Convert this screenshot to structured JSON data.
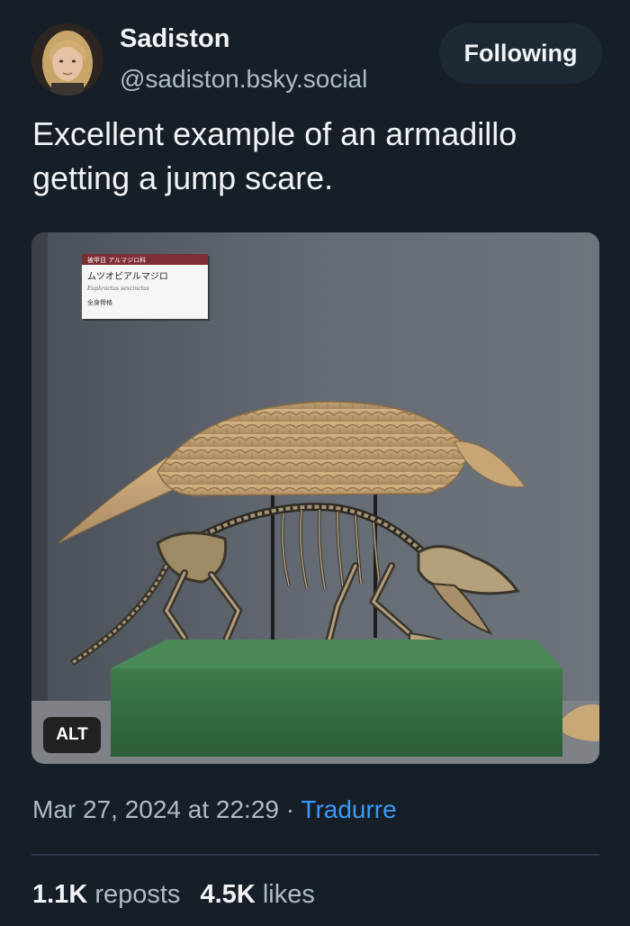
{
  "author": {
    "display_name": "Sadiston",
    "handle": "@sadiston.bsky.social"
  },
  "follow_button": {
    "label": "Following"
  },
  "post": {
    "text": "Excellent example of an armadillo getting a jump scare.",
    "image": {
      "alt_badge": "ALT",
      "label_card": {
        "line1": "被甲目 アルマジロ科",
        "line2": "ムツオビアルマジロ",
        "line3": "Euphractus sexcinctus",
        "line4": "全身骨格"
      }
    },
    "timestamp": "Mar 27, 2024 at 22:29",
    "separator": " · ",
    "translate_label": "Tradurre"
  },
  "stats": {
    "reposts_count": "1.1K",
    "reposts_label": "reposts",
    "likes_count": "4.5K",
    "likes_label": "likes"
  },
  "colors": {
    "background": "#161e27",
    "follow_button_bg": "#1e2936",
    "link": "#3b9af8",
    "muted_text": "#aebbc9"
  }
}
